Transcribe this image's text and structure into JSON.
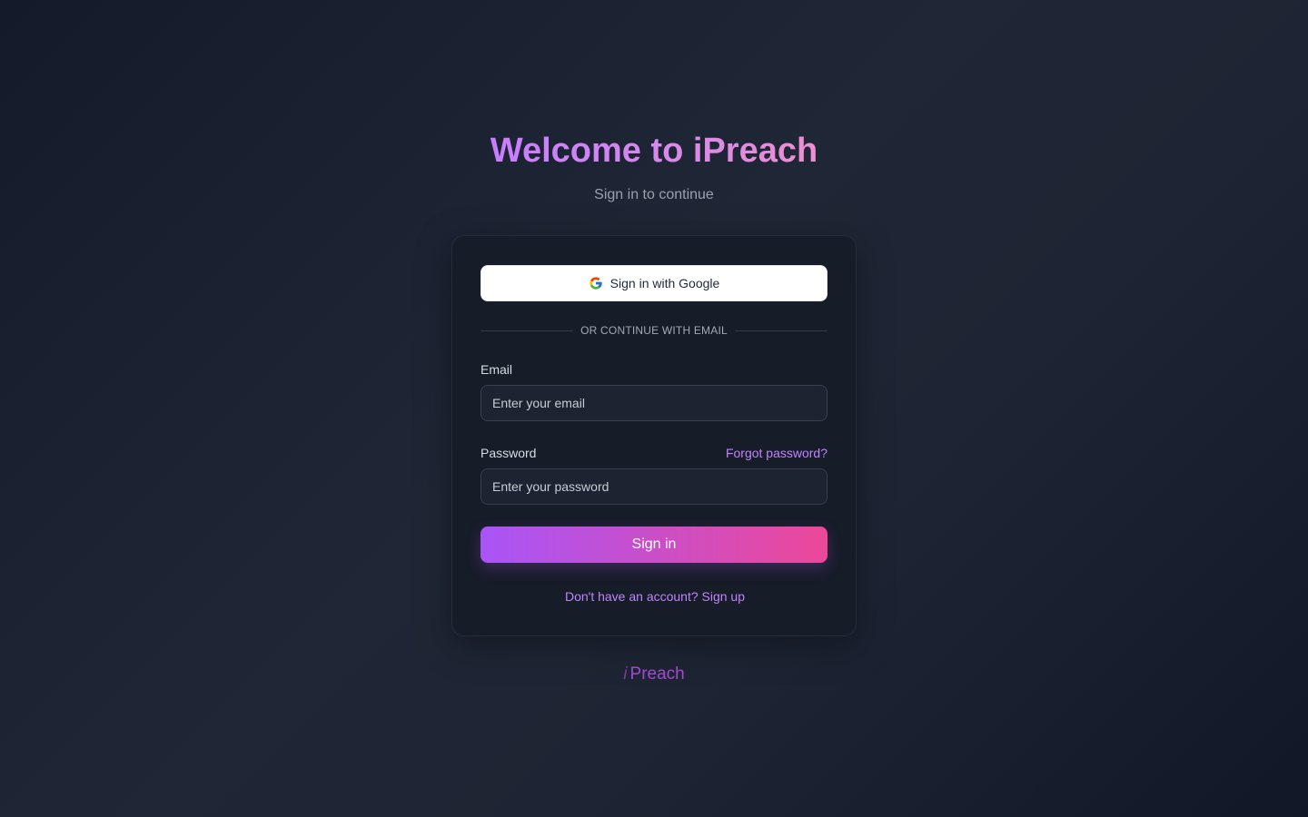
{
  "header": {
    "title": "Welcome to iPreach",
    "subtitle": "Sign in to continue"
  },
  "form": {
    "google_button_label": "Sign in with Google",
    "divider_text": "OR CONTINUE WITH EMAIL",
    "email_label": "Email",
    "email_placeholder": "Enter your email",
    "email_value": "",
    "password_label": "Password",
    "forgot_password_label": "Forgot password?",
    "password_placeholder": "Enter your password",
    "password_value": "",
    "submit_label": "Sign in",
    "signup_text": "Don't have an account? Sign up"
  },
  "footer": {
    "logo_icon": "i",
    "logo_text": "Preach"
  },
  "icons": {
    "google": "google-icon"
  },
  "colors": {
    "accent_start": "#a855f7",
    "accent_end": "#ec4899",
    "link": "#c084fc",
    "background": "#1f2736",
    "card": "#171c29"
  }
}
